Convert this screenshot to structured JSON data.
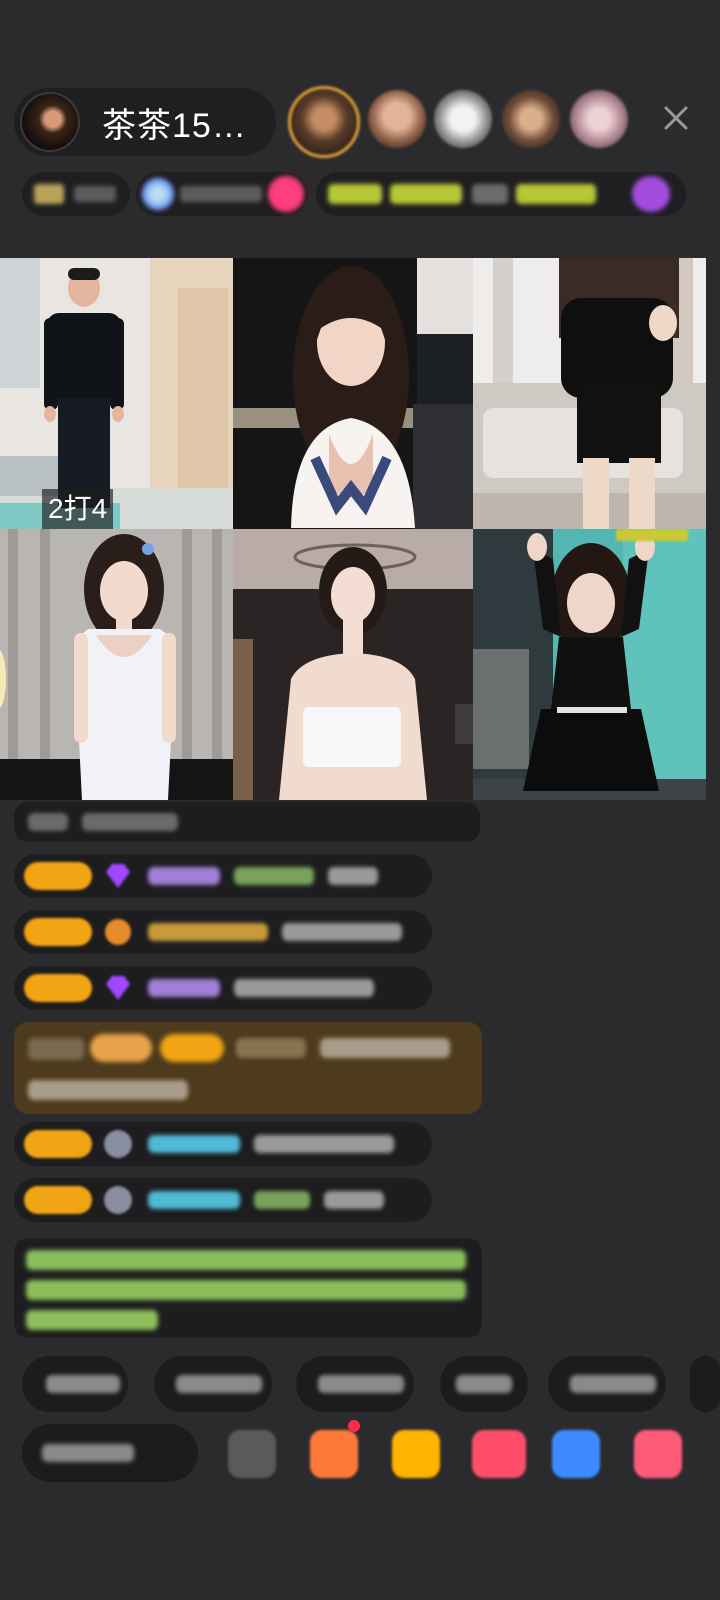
{
  "header": {
    "host_name": "茶茶15…",
    "close_icon": "close-icon"
  },
  "grid": {
    "pk_label": "2打4"
  },
  "colors": {
    "background": "#2b2b2d",
    "pill": "#1f1f21",
    "featured_bg": "#4e3a1c",
    "badge_gold": "#f2a514",
    "gem_purple": "#9b4dff",
    "name_cyan": "#4fb9d6",
    "notice_green": "#9ccf68"
  }
}
